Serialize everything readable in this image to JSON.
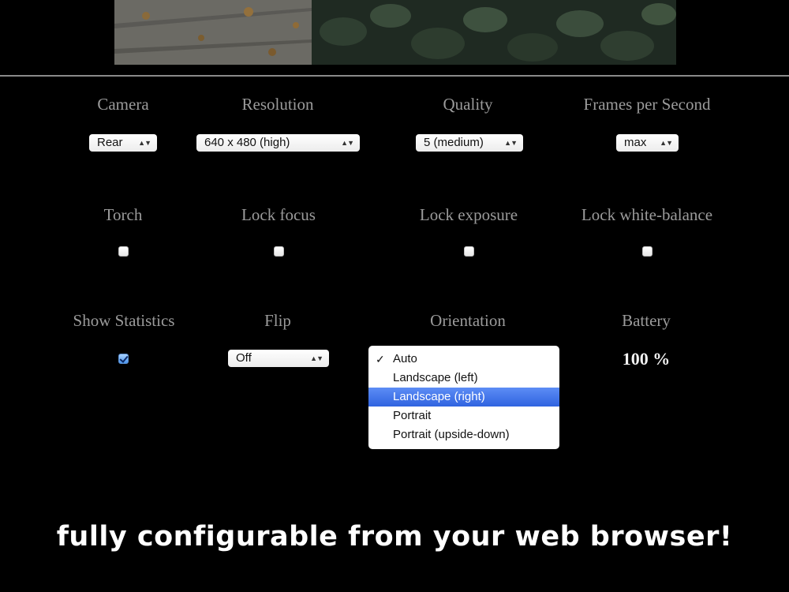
{
  "settings": {
    "camera": {
      "label": "Camera",
      "value": "Rear"
    },
    "resolution": {
      "label": "Resolution",
      "value": "640 x 480 (high)"
    },
    "quality": {
      "label": "Quality",
      "value": "5 (medium)"
    },
    "fps": {
      "label": "Frames per Second",
      "value": "max"
    },
    "torch": {
      "label": "Torch",
      "checked": false
    },
    "lock_focus": {
      "label": "Lock focus",
      "checked": false
    },
    "lock_exposure": {
      "label": "Lock exposure",
      "checked": false
    },
    "lock_white_balance": {
      "label": "Lock white-balance",
      "checked": false
    },
    "show_statistics": {
      "label": "Show Statistics",
      "checked": true
    },
    "flip": {
      "label": "Flip",
      "value": "Off"
    },
    "orientation": {
      "label": "Orientation",
      "selected": "Auto",
      "highlighted": "Landscape (right)",
      "check_mark": "✓",
      "options": [
        "Auto",
        "Landscape (left)",
        "Landscape (right)",
        "Portrait",
        "Portrait (upside-down)"
      ]
    },
    "battery": {
      "label": "Battery",
      "value": "100 %"
    }
  },
  "icons": {
    "select_arrows": "up-down-chevron-icon",
    "arrows_glyph": "▲▼"
  },
  "tagline": "fully configurable from your web browser!",
  "colors": {
    "background": "#000000",
    "label": "#9b9b9b",
    "highlight": "#3a6fe6",
    "tagline": "#ffffff"
  }
}
